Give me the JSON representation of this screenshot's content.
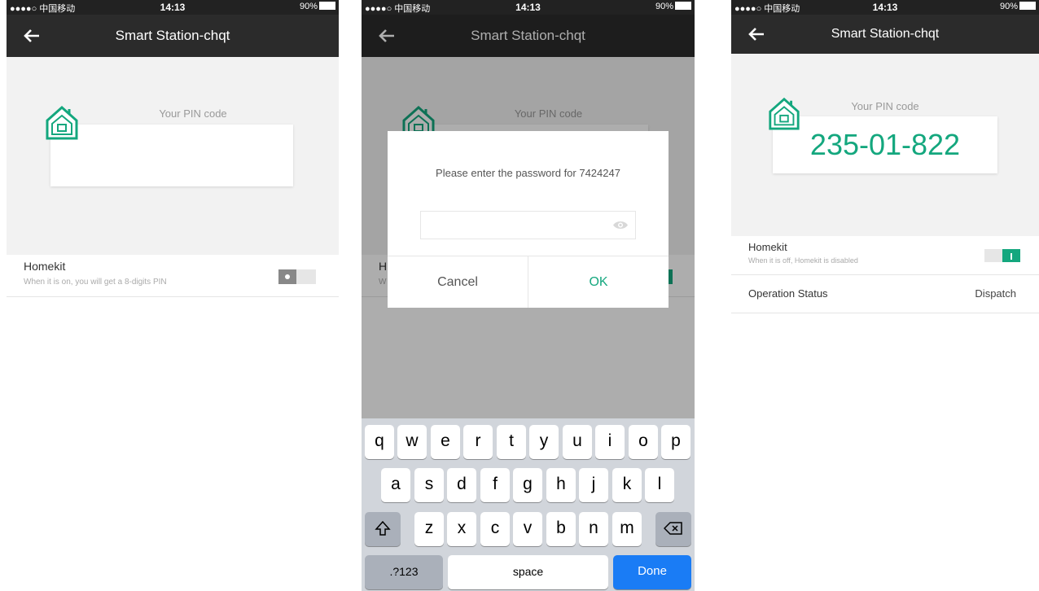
{
  "status_bar": {
    "carrier": "●●●●○ 中国移动 ",
    "time": "14:13",
    "battery": "90%"
  },
  "screens": [
    {
      "nav_title": "Smart Station-chqt",
      "pin_label": "Your PIN code",
      "pin_code": "",
      "homekit": {
        "title": "Homekit",
        "subtitle": "When it is on, you will get a 8-digits PIN",
        "enabled": false
      }
    },
    {
      "nav_title": "Smart Station-chqt",
      "pin_label": "Your PIN code",
      "homekit": {
        "title": "H",
        "subtitle": "W"
      },
      "dialog": {
        "message": "Please enter the password for 7424247",
        "password_value": "",
        "cancel_label": "Cancel",
        "ok_label": "OK"
      },
      "keyboard": {
        "row1": [
          "q",
          "w",
          "e",
          "r",
          "t",
          "y",
          "u",
          "i",
          "o",
          "p"
        ],
        "row2": [
          "a",
          "s",
          "d",
          "f",
          "g",
          "h",
          "j",
          "k",
          "l"
        ],
        "row3": [
          "z",
          "x",
          "c",
          "v",
          "b",
          "n",
          "m"
        ],
        "shift_icon": "shift-arrow-icon",
        "backspace_icon": "backspace-icon",
        "numbers_label": ".?123",
        "space_label": "space",
        "done_label": "Done"
      }
    },
    {
      "nav_title": "Smart Station-chqt",
      "pin_label": "Your PIN code",
      "pin_code": "235-01-822",
      "homekit": {
        "title": "Homekit",
        "subtitle": "When it is off, Homekit is disabled",
        "enabled": true
      },
      "operation": {
        "title": "Operation Status",
        "value": "Dispatch"
      }
    }
  ],
  "colors": {
    "accent": "#14a77e",
    "navbar": "#2b2b2b",
    "ios_blue": "#1a7cf5"
  }
}
